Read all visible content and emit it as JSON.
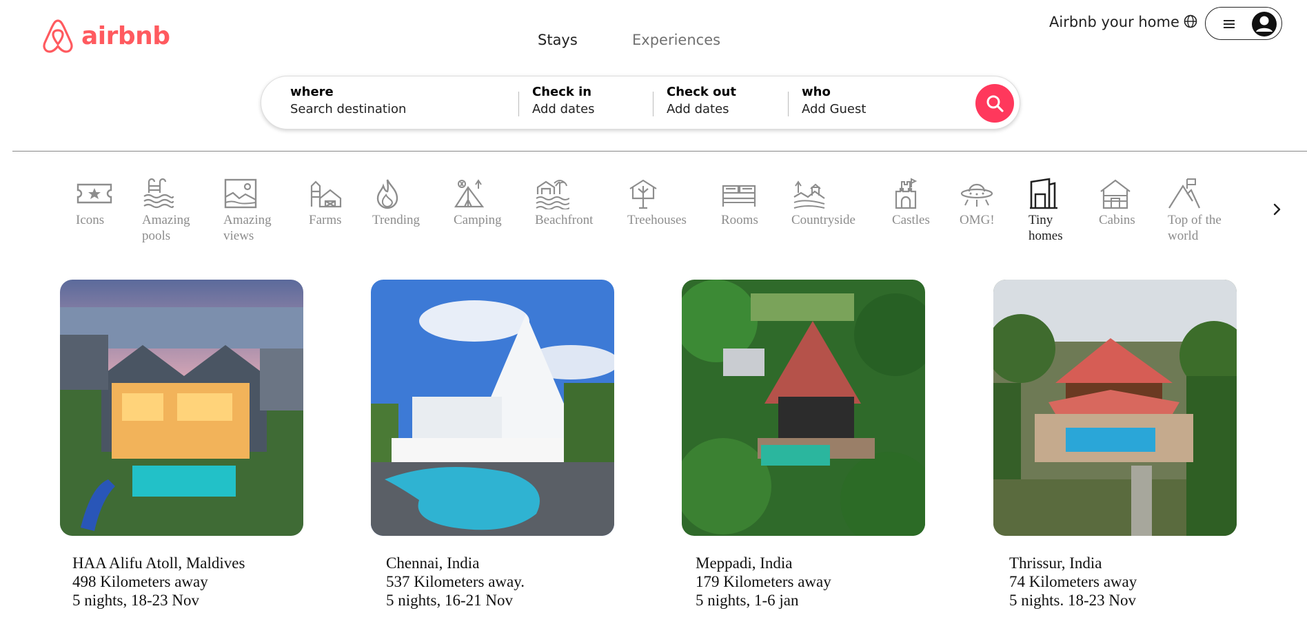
{
  "brand": {
    "name": "airbnb",
    "color": "#ff5a5f"
  },
  "nav": {
    "tabs": [
      "Stays",
      "Experiences"
    ],
    "active": "Stays"
  },
  "header": {
    "host_link": "Airbnb your home"
  },
  "search": {
    "fields": [
      {
        "label": "where",
        "value": "Search destination"
      },
      {
        "label": "Check in",
        "value": "Add dates"
      },
      {
        "label": "Check out",
        "value": "Add dates"
      },
      {
        "label": "who",
        "value": "Add Guest"
      }
    ],
    "button_color": "#ff385c"
  },
  "categories": [
    {
      "icon": "ticket-icon",
      "label": "Icons"
    },
    {
      "icon": "pool-icon",
      "label": "Amazing pools"
    },
    {
      "icon": "picture-icon",
      "label": "Amazing views"
    },
    {
      "icon": "barn-icon",
      "label": "Farms"
    },
    {
      "icon": "flame-icon",
      "label": "Trending"
    },
    {
      "icon": "tent-icon",
      "label": "Camping"
    },
    {
      "icon": "beach-house-icon",
      "label": "Beachfront"
    },
    {
      "icon": "treehouse-icon",
      "label": "Treehouses"
    },
    {
      "icon": "bed-icon",
      "label": "Rooms"
    },
    {
      "icon": "countryside-icon",
      "label": "Countryside"
    },
    {
      "icon": "castle-icon",
      "label": "Castles"
    },
    {
      "icon": "ufo-icon",
      "label": "OMG!"
    },
    {
      "icon": "tiny-home-icon",
      "label": "Tiny homes",
      "active": true
    },
    {
      "icon": "cabin-icon",
      "label": "Cabins"
    },
    {
      "icon": "mountain-flag-icon",
      "label": "Top of the world"
    }
  ],
  "listings": [
    {
      "location": "HAA Alifu Atoll, Maldives",
      "distance": "498 Kilometers away",
      "dates": "5 nights, 18-23 Nov"
    },
    {
      "location": "Chennai, India",
      "distance": "537 Kilometers away.",
      "dates": "5 nights, 16-21 Nov"
    },
    {
      "location": "Meppadi, India",
      "distance": "179 Kilometers away",
      "dates": "5 nights, 1-6 jan"
    },
    {
      "location": "Thrissur, India",
      "distance": "74 Kilometers away",
      "dates": "5 nights. 18-23 Nov"
    }
  ]
}
